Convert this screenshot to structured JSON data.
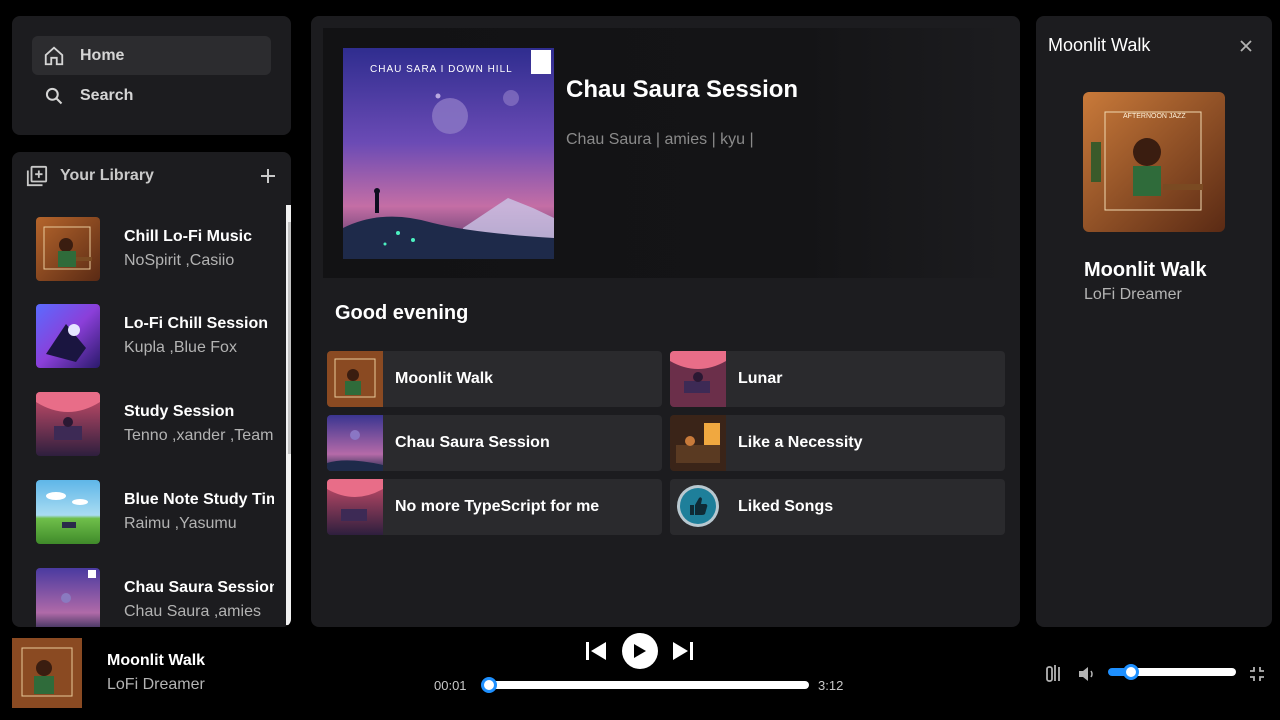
{
  "nav": {
    "home_label": "Home",
    "search_label": "Search"
  },
  "library": {
    "title": "Your Library",
    "items": [
      {
        "name": "Chill Lo-Fi Music",
        "artists": "NoSpirit ,Casiio"
      },
      {
        "name": "Lo-Fi Chill Session",
        "artists": "Kupla ,Blue Fox"
      },
      {
        "name": "Study Session",
        "artists": "Tenno ,xander ,Team"
      },
      {
        "name": "Blue Note Study Time",
        "artists": "Raimu ,Yasumu"
      },
      {
        "name": "Chau Saura Session",
        "artists": "Chau Saura ,amies"
      }
    ]
  },
  "hero": {
    "cover_text": "CHAU SARA I DOWN HILL",
    "title": "Chau Saura Session",
    "subtitle": "Chau Saura | amies | kyu |"
  },
  "main": {
    "greeting": "Good evening",
    "cards": [
      {
        "label": "Moonlit Walk"
      },
      {
        "label": "Lunar"
      },
      {
        "label": "Chau Saura Session"
      },
      {
        "label": "Like a Necessity"
      },
      {
        "label": "No more TypeScript for me"
      },
      {
        "label": "Liked Songs"
      }
    ]
  },
  "right_panel": {
    "title": "Moonlit Walk",
    "cover_text": "AFTERNOON JAZZ",
    "song": "Moonlit Walk",
    "artist": "LoFi Dreamer"
  },
  "player": {
    "title": "Moonlit Walk",
    "artist": "LoFi Dreamer",
    "elapsed": "00:01",
    "duration": "3:12",
    "progress_fraction": 0.005,
    "volume_fraction": 0.1
  },
  "colors": {
    "accent": "#1e90ff",
    "panel": "#1c1c1f",
    "card": "#2a2a2d"
  }
}
